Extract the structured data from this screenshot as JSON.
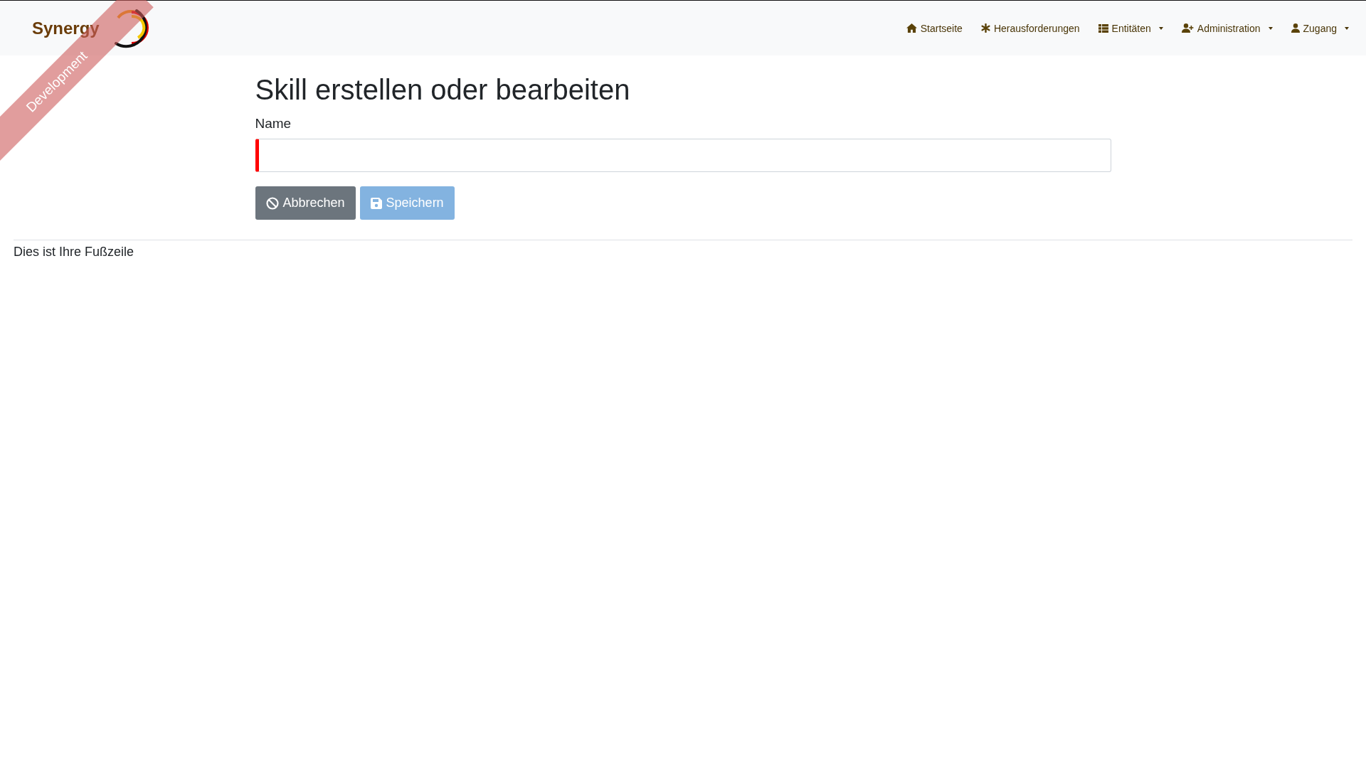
{
  "brand": {
    "name": "Synergy"
  },
  "ribbon": {
    "label": "Development"
  },
  "nav": [
    {
      "label": "Startseite",
      "dropdown": false
    },
    {
      "label": "Herausforderungen",
      "dropdown": false
    },
    {
      "label": "Entitäten",
      "dropdown": true
    },
    {
      "label": "Administration",
      "dropdown": true
    },
    {
      "label": "Zugang",
      "dropdown": true
    }
  ],
  "heading": "Skill erstellen oder bearbeiten",
  "form": {
    "label": "Name",
    "invalid": true
  },
  "buttons": [
    {
      "label": "Abbrechen",
      "kind": "cancel",
      "disabled": false
    },
    {
      "label": "Speichern",
      "kind": "save",
      "disabled": true
    }
  ],
  "footer": "Dies ist Ihre Fußzeile"
}
